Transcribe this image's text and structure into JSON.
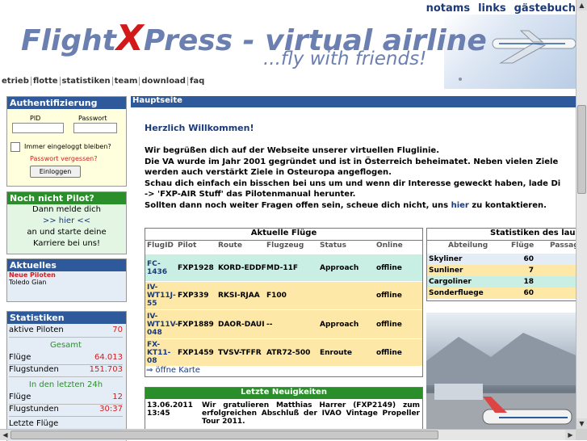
{
  "header": {
    "toplinks": [
      "notams",
      "links",
      "gästebuch"
    ],
    "logo_main": "Flight",
    "logo_x": "X",
    "logo_rest": "Press - virtual airline",
    "tagline": "...fly with friends!"
  },
  "nav": [
    "etrieb",
    "flotte",
    "statistiken",
    "team",
    "download",
    "faq"
  ],
  "auth": {
    "title": "Authentifizierung",
    "pid_label": "PID",
    "pw_label": "Passwort",
    "remember": "Immer eingeloggt bleiben?",
    "forgot": "Passwort vergessen?",
    "login": "Einloggen"
  },
  "pilot": {
    "title": "Noch nicht Pilot?",
    "line1": "Dann melde dich",
    "line2": ">> hier <<",
    "line3": "an und starte deine",
    "line4": "Karriere bei uns!"
  },
  "news_left": {
    "title": "Aktuelles",
    "sub": "Neue Piloten",
    "name": "Toledo Gian"
  },
  "stats_left": {
    "title": "Statistiken",
    "active_label": "aktive Piloten",
    "active_value": "70",
    "total_header": "Gesamt",
    "flights_label": "Flüge",
    "flights_value": "64.013",
    "hours_label": "Flugstunden",
    "hours_value": "151.703",
    "recent_header": "In den letzten 24h",
    "r_flights_label": "Flüge",
    "r_flights_value": "12",
    "r_hours_label": "Flugstunden",
    "r_hours_value": "30:37",
    "last_label": "Letzte Flüge"
  },
  "main": {
    "title": "Hauptseite",
    "welcome": "Herzlich Willkommen!",
    "intro1": "Wir begrüßen dich auf der Webseite unserer virtuellen Fluglinie.",
    "intro2": "Die VA wurde im Jahr 2001 gegründet und ist in Österreich beheimatet. Neben vielen Ziele",
    "intro3": "werden auch verstärkt Ziele in Osteuropa angeflogen.",
    "intro4": "Schau dich einfach ein bisschen bei uns um und wenn dir Interesse geweckt haben, lade Di",
    "intro5": "-> 'FXP-AIR Stuff' das Pilotenmanual herunter.",
    "intro6a": "Sollten dann noch weiter Fragen offen sein, scheue dich nicht, uns ",
    "intro6_link": "hier",
    "intro6b": " zu kontaktieren."
  },
  "flights": {
    "title": "Aktuelle Flüge",
    "headers": [
      "FlugID",
      "Pilot",
      "Route",
      "Flugzeug",
      "Status",
      "Online"
    ],
    "rows": [
      {
        "id": "FC-1436",
        "pilot": "FXP1928",
        "route": "KORD-EDDF",
        "plane": "MD-11F",
        "status": "Approach",
        "online": "offline",
        "bg": "#c9eee4"
      },
      {
        "id": "IV-WT11J-55",
        "pilot": "FXP339",
        "route": "RKSI-RJAA",
        "plane": "F100",
        "status": "",
        "online": "offline",
        "bg": "#fde8a8"
      },
      {
        "id": "IV-WT11V-048",
        "pilot": "FXP1889",
        "route": "DAOR-DAUI",
        "plane": "--",
        "status": "Approach",
        "online": "offline",
        "bg": "#fde8a8"
      },
      {
        "id": "FX-KT11-08",
        "pilot": "FXP1459",
        "route": "TVSV-TFFR",
        "plane": "ATR72-500",
        "status": "Enroute",
        "online": "offline",
        "bg": "#fde8a8"
      }
    ],
    "map_link": "⇒ öffne Karte"
  },
  "stats_right": {
    "title": "Statistiken des lau",
    "headers": [
      "Abteilung",
      "Flüge",
      "Passag"
    ],
    "rows": [
      {
        "name": "Skyliner",
        "value": "60",
        "bg": "#e4ecf6"
      },
      {
        "name": "Sunliner",
        "value": "7",
        "bg": "#fde8a8"
      },
      {
        "name": "Cargoliner",
        "value": "18",
        "bg": "#c9eee4"
      },
      {
        "name": "Sonderfluege",
        "value": "60",
        "bg": "#fde8a8"
      }
    ]
  },
  "news": {
    "title": "Letzte Neuigkeiten",
    "date": "13.06.2011",
    "time": "13:45",
    "text": "Wir gratulieren Matthias Harrer (FXP2149) zum erfolgreichen Abschluß der IVAO Vintage Propeller Tour 2011."
  },
  "colors": {
    "accent_blue": "#2e5a9c",
    "accent_green": "#2a8f2a",
    "logo_red": "#d21a1a"
  }
}
